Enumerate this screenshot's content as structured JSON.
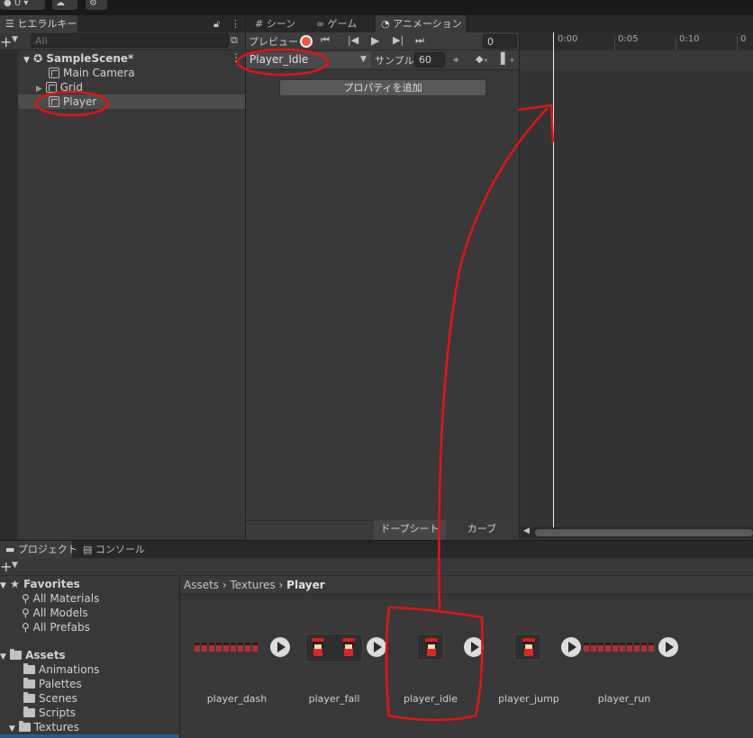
{
  "topbar": {
    "account_label": "U",
    "cloud_icon": "cloud-icon",
    "collab_icon": "collab-icon"
  },
  "hierarchy": {
    "tab_label": "ヒエラルキー",
    "search_placeholder": "All",
    "scene_name": "SampleScene*",
    "items": [
      {
        "label": "Main Camera"
      },
      {
        "label": "Grid"
      },
      {
        "label": "Player"
      }
    ]
  },
  "center_tabs": [
    {
      "label": "シーン",
      "icon": "grid-icon"
    },
    {
      "label": "ゲーム",
      "icon": "gamepad-icon"
    },
    {
      "label": "アニメーション",
      "icon": "clock-icon"
    }
  ],
  "animation": {
    "preview_label": "プレビュー",
    "frame_value": "0",
    "clip_name": "Player_Idle",
    "sample_label": "サンプル",
    "sample_value": "60",
    "add_property_label": "プロパティを追加",
    "dopesheet_label": "ドープシート",
    "curves_label": "カーブ",
    "ticks": [
      "0:00",
      "0:05",
      "0:10",
      "0"
    ]
  },
  "bottom_tabs": [
    {
      "label": "プロジェクト",
      "icon": "folder-icon"
    },
    {
      "label": "コンソール",
      "icon": "console-icon"
    }
  ],
  "project": {
    "favorites_label": "Favorites",
    "favorites": [
      "All Materials",
      "All Models",
      "All Prefabs"
    ],
    "assets_label": "Assets",
    "folders": [
      "Animations",
      "Palettes",
      "Scenes",
      "Scripts",
      "Textures"
    ],
    "breadcrumb": [
      "Assets",
      "Textures",
      "Player"
    ],
    "assets": [
      {
        "name": "player_dash"
      },
      {
        "name": "player_fall"
      },
      {
        "name": "player_idle"
      },
      {
        "name": "player_jump"
      },
      {
        "name": "player_run"
      }
    ]
  },
  "colors": {
    "annotation": "#e01515",
    "panel": "#383838",
    "selected_row": "#4d4d4d"
  }
}
